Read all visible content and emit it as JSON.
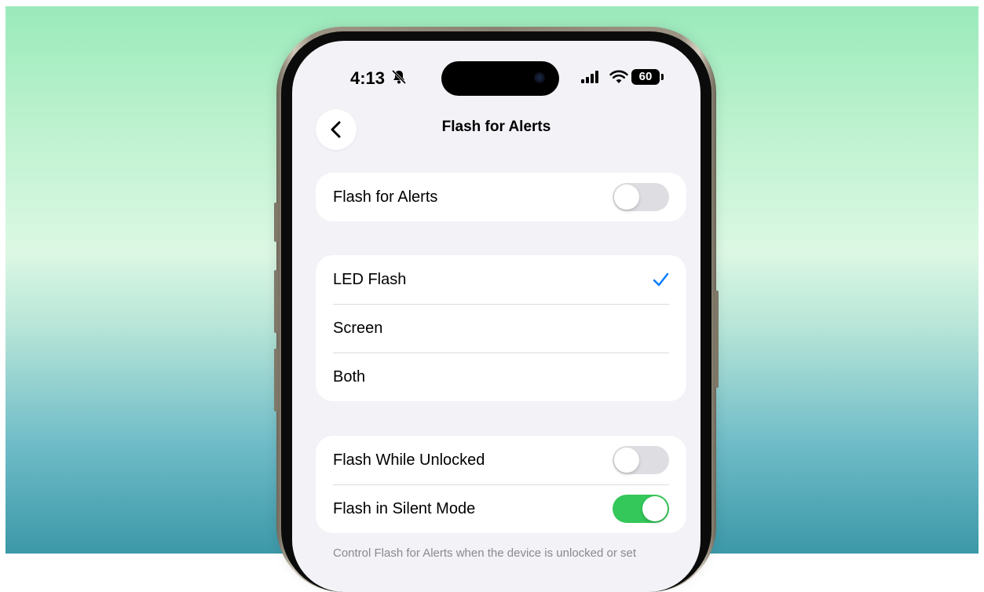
{
  "status_bar": {
    "time": "4:13",
    "battery": "60"
  },
  "nav": {
    "title": "Flash for Alerts",
    "back_icon": "chevron-left-icon"
  },
  "main_toggle": {
    "label": "Flash for Alerts",
    "on": false
  },
  "flash_options": [
    {
      "label": "LED Flash",
      "selected": true
    },
    {
      "label": "Screen",
      "selected": false
    },
    {
      "label": "Both",
      "selected": false
    }
  ],
  "conditions": [
    {
      "label": "Flash While Unlocked",
      "on": false
    },
    {
      "label": "Flash in Silent Mode",
      "on": true
    }
  ],
  "footnote": "Control Flash for Alerts when the device is unlocked or set",
  "colors": {
    "accent": "#007aff",
    "toggle_on": "#34c759",
    "toggle_off": "#dedee2",
    "screen_bg": "#f2f2f7"
  }
}
